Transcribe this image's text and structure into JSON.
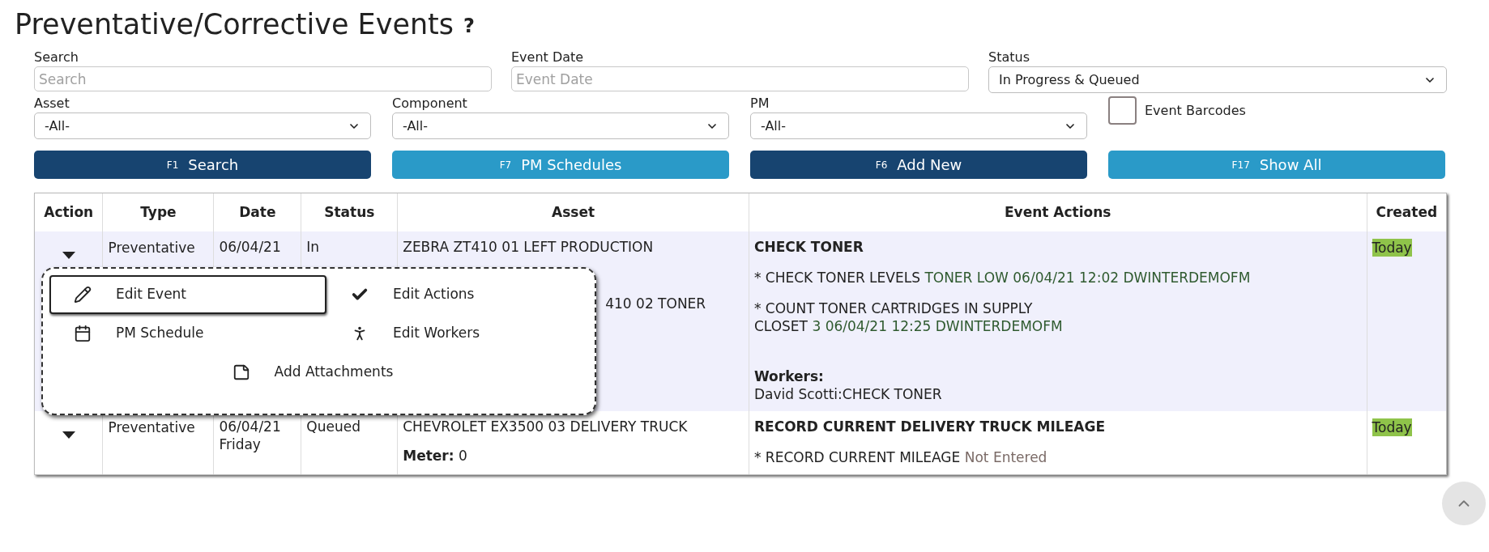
{
  "page": {
    "title": "Preventative/Corrective Events",
    "help": "?"
  },
  "filters": {
    "search": {
      "label": "Search",
      "placeholder": "Search"
    },
    "event_date": {
      "label": "Event Date",
      "placeholder": "Event Date"
    },
    "status": {
      "label": "Status",
      "value": "In Progress & Queued"
    },
    "asset": {
      "label": "Asset",
      "value": "-All-"
    },
    "component": {
      "label": "Component",
      "value": "-All-"
    },
    "pm": {
      "label": "PM",
      "value": "-All-"
    },
    "event_barcodes": {
      "label": "Event Barcodes",
      "checked": false
    }
  },
  "buttons": [
    {
      "key": "F1",
      "label": "Search",
      "kind": "primary"
    },
    {
      "key": "F7",
      "label": "PM Schedules",
      "kind": "secondary"
    },
    {
      "key": "F6",
      "label": "Add New",
      "kind": "primary"
    },
    {
      "key": "F17",
      "label": "Show All",
      "kind": "secondary"
    }
  ],
  "table": {
    "columns": [
      "Action",
      "Type",
      "Date",
      "Status",
      "Asset",
      "Event Actions",
      "Created"
    ],
    "rows": [
      {
        "selected": true,
        "type": "Preventative",
        "date": "06/04/21",
        "status": "In",
        "asset": "ZEBRA ZT410 01 LEFT PRODUCTION",
        "component": "410 02 TONER",
        "event_title": "CHECK TONER",
        "steps": [
          {
            "text": "* CHECK TONER LEVELS",
            "result": "TONER LOW 06/04/21 12:02 DWINTERDEMOFM",
            "kind": "entered"
          },
          {
            "text": "* COUNT TONER CARTRIDGES IN SUPPLY\nCLOSET",
            "result": "3 06/04/21 12:25 DWINTERDEMOFM",
            "kind": "entered"
          }
        ],
        "workers_label": "Workers:",
        "workers": "David Scotti:CHECK TONER",
        "created": "Today"
      },
      {
        "selected": false,
        "type": "Preventative",
        "date": "06/04/21",
        "day": "Friday",
        "status": "Queued",
        "asset": "CHEVROLET EX3500 03 DELIVERY TRUCK",
        "meter": "**Meter:** 0",
        "event_title": "RECORD CURRENT DELIVERY TRUCK MILEAGE",
        "steps": [
          {
            "text": "* RECORD CURRENT MILEAGE",
            "result": "Not Entered",
            "kind": "missing"
          }
        ],
        "created": "Today"
      }
    ]
  },
  "action_menu": {
    "items": [
      {
        "label": "Edit Event",
        "selected": true
      },
      {
        "label": "Edit Actions",
        "selected": false
      },
      {
        "label": "PM Schedule",
        "selected": false
      },
      {
        "label": "Edit Workers",
        "selected": false
      },
      {
        "label": "Add Attachments",
        "selected": false
      }
    ]
  }
}
